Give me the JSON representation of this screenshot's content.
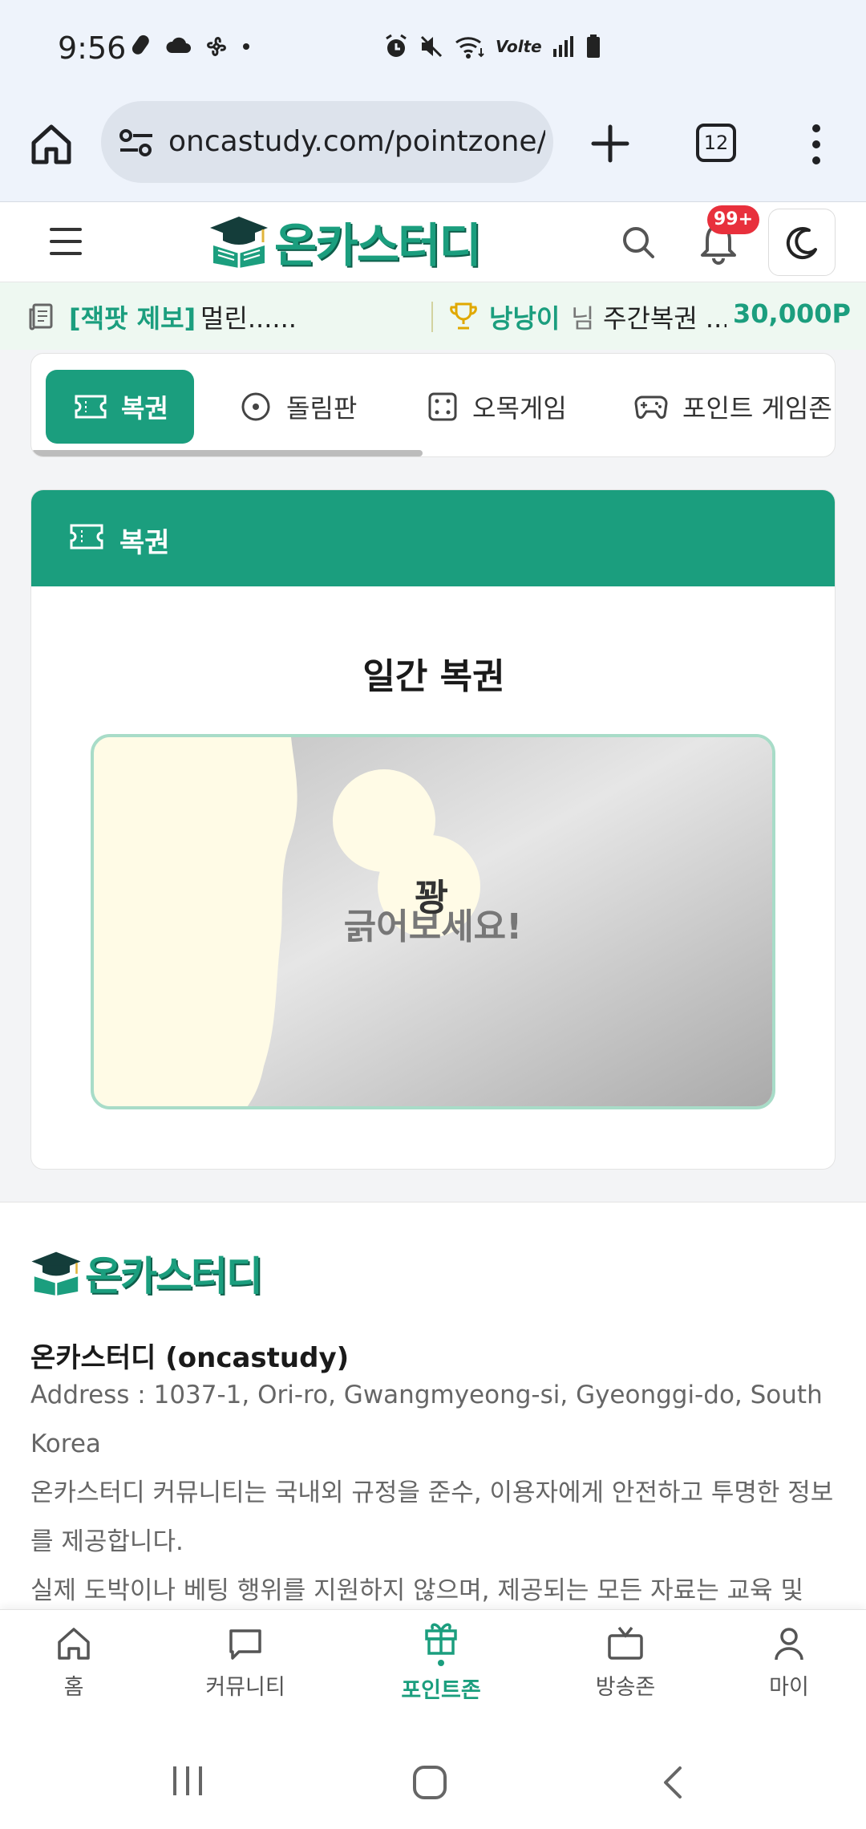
{
  "status_bar": {
    "time": "9:56",
    "left_icons": [
      "nfc-icon",
      "cloud-icon",
      "fan-icon",
      "dot"
    ],
    "right_icons": [
      "alarm-icon",
      "mute-icon",
      "wifi-icon",
      "volte-label",
      "signal-icon",
      "battery-icon"
    ],
    "volte": "Volte"
  },
  "browser": {
    "url": "oncastudy.com/pointzone/l",
    "tab_count": "12"
  },
  "header": {
    "logo_text": "온카스터디",
    "notification_badge": "99+"
  },
  "ticker": {
    "tag": "[잭팟 제보]",
    "news": "멀린......",
    "winner": "낭낭이",
    "honorific": "님",
    "desc": "주간복권 ...",
    "points": "30,000P"
  },
  "tabs": [
    {
      "label": "복권",
      "icon": "ticket-icon",
      "active": true
    },
    {
      "label": "돌림판",
      "icon": "wheel-icon",
      "active": false
    },
    {
      "label": "오목게임",
      "icon": "dice-icon",
      "active": false
    },
    {
      "label": "포인트 게임존",
      "icon": "gamepad-icon",
      "active": false
    }
  ],
  "lottery": {
    "header": "복권",
    "title": "일간 복권",
    "prompt": "긁어보세요!",
    "result": "꽝"
  },
  "footer": {
    "logo_text": "온카스터디",
    "company": "온카스터디 (oncastudy)",
    "address": "Address : 1037-1, Ori-ro, Gwangmyeong-si, Gyeonggi-do, South Korea",
    "desc1": "온카스터디 커뮤니티는 국내외 규정을 준수, 이용자에게 안전하고 투명한 정보를 제공합니다.",
    "desc2": "실제 도박이나 베팅 행위를 지원하지 않으며, 제공되는 모든 자료는 교육 및"
  },
  "bottom_nav": [
    {
      "label": "홈",
      "icon": "home-icon",
      "active": false
    },
    {
      "label": "커뮤니티",
      "icon": "chat-icon",
      "active": false
    },
    {
      "label": "포인트존",
      "icon": "gift-icon",
      "active": true
    },
    {
      "label": "방송존",
      "icon": "tv-icon",
      "active": false
    },
    {
      "label": "마이",
      "icon": "user-icon",
      "active": false
    }
  ],
  "colors": {
    "brand": "#1b9e7e",
    "badge": "#e8303c",
    "scratch_border": "#a8dcc8",
    "scratch_reveal": "#fffbe6"
  }
}
